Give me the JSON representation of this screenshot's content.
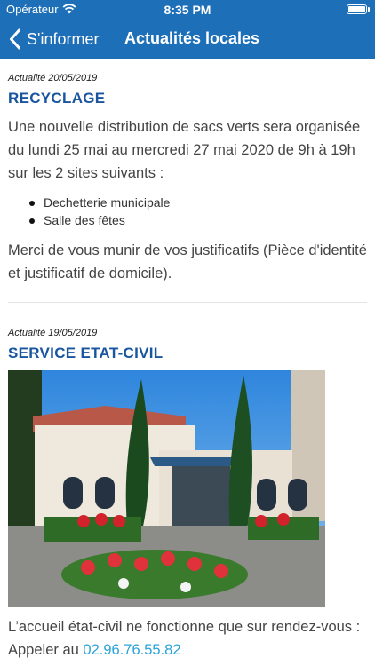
{
  "status_bar": {
    "carrier": "Opérateur",
    "time": "8:35 PM",
    "battery_level": 1.0
  },
  "nav": {
    "back_label": "S'informer",
    "title": "Actualités locales"
  },
  "colors": {
    "nav_bar": "#1d6fb8",
    "heading": "#1a56a0",
    "link": "#29a3d8"
  },
  "articles": [
    {
      "date": "Actualité 20/05/2019",
      "title": "RECYCLAGE",
      "intro": "Une nouvelle distribution de sacs verts sera organisée du lundi 25 mai au mercredi 27 mai 2020 de 9h à 19h sur les 2 sites suivants :",
      "bullets": [
        "Dechetterie municipale",
        "Salle des fêtes"
      ],
      "outro": "Merci de vous munir de vos justificatifs (Pièce d'identité et justificatif de domicile)."
    },
    {
      "date": "Actualité 19/05/2019",
      "title": "SERVICE ETAT-CIVIL",
      "image": "town-hall-photo",
      "text": "L’accueil état-civil ne fonctionne que sur rendez-vous :",
      "phone_prefix": "Appeler au",
      "phone": "02.96.76.55.82"
    }
  ]
}
